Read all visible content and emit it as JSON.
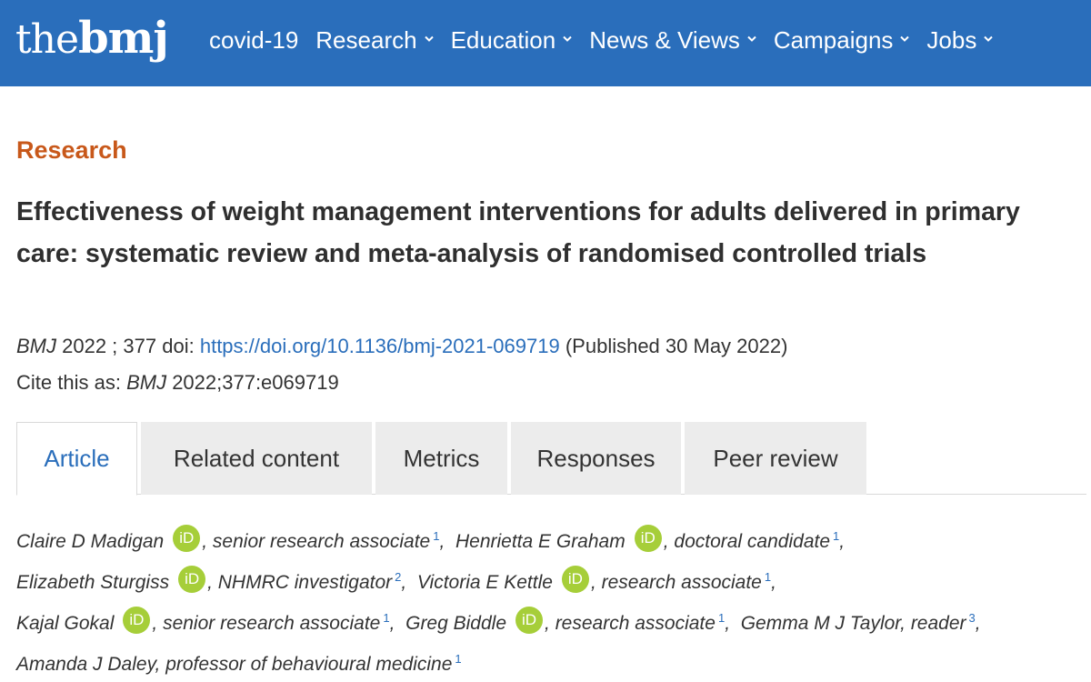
{
  "header": {
    "logo_the": "the",
    "logo_bmj": "bmj",
    "nav": [
      {
        "label": "covid-19",
        "has_dropdown": false
      },
      {
        "label": "Research",
        "has_dropdown": true
      },
      {
        "label": "Education",
        "has_dropdown": true
      },
      {
        "label": "News & Views",
        "has_dropdown": true
      },
      {
        "label": "Campaigns",
        "has_dropdown": true
      },
      {
        "label": "Jobs",
        "has_dropdown": true
      }
    ]
  },
  "article": {
    "section": "Research",
    "title": "Effectiveness of weight management interventions for adults delivered in primary care: systematic review and meta-analysis of randomised controlled trials",
    "journal": "BMJ",
    "year_volume": "2022 ; 377",
    "doi_label": "doi:",
    "doi_url": "https://doi.org/10.1136/bmj-2021-069719",
    "published": "(Published 30 May 2022)",
    "cite_label": "Cite this as:",
    "cite_journal": "BMJ",
    "cite_ref": "2022;377:e069719"
  },
  "tabs": [
    "Article",
    "Related content",
    "Metrics",
    "Responses",
    "Peer review"
  ],
  "active_tab": "Article",
  "orcid_label": "iD",
  "authors": [
    {
      "name": "Claire D Madigan",
      "orcid": true,
      "role": "senior research associate",
      "aff": "1"
    },
    {
      "name": "Henrietta E Graham",
      "orcid": true,
      "role": "doctoral candidate",
      "aff": "1"
    },
    {
      "name": "Elizabeth Sturgiss",
      "orcid": true,
      "role": "NHMRC investigator",
      "aff": "2"
    },
    {
      "name": "Victoria E Kettle",
      "orcid": true,
      "role": "research associate",
      "aff": "1"
    },
    {
      "name": "Kajal Gokal",
      "orcid": true,
      "role": "senior research associate",
      "aff": "1"
    },
    {
      "name": "Greg Biddle",
      "orcid": true,
      "role": "research associate",
      "aff": "1"
    },
    {
      "name": "Gemma M J Taylor",
      "orcid": false,
      "role": "reader",
      "aff": "3"
    },
    {
      "name": "Amanda J Daley",
      "orcid": false,
      "role": "professor of behavioural medicine",
      "aff": "1"
    }
  ],
  "colors": {
    "brand_blue": "#2a6ebb",
    "section_orange": "#c8581a",
    "orcid_green": "#a6ce39",
    "tab_bg": "#ececec"
  }
}
